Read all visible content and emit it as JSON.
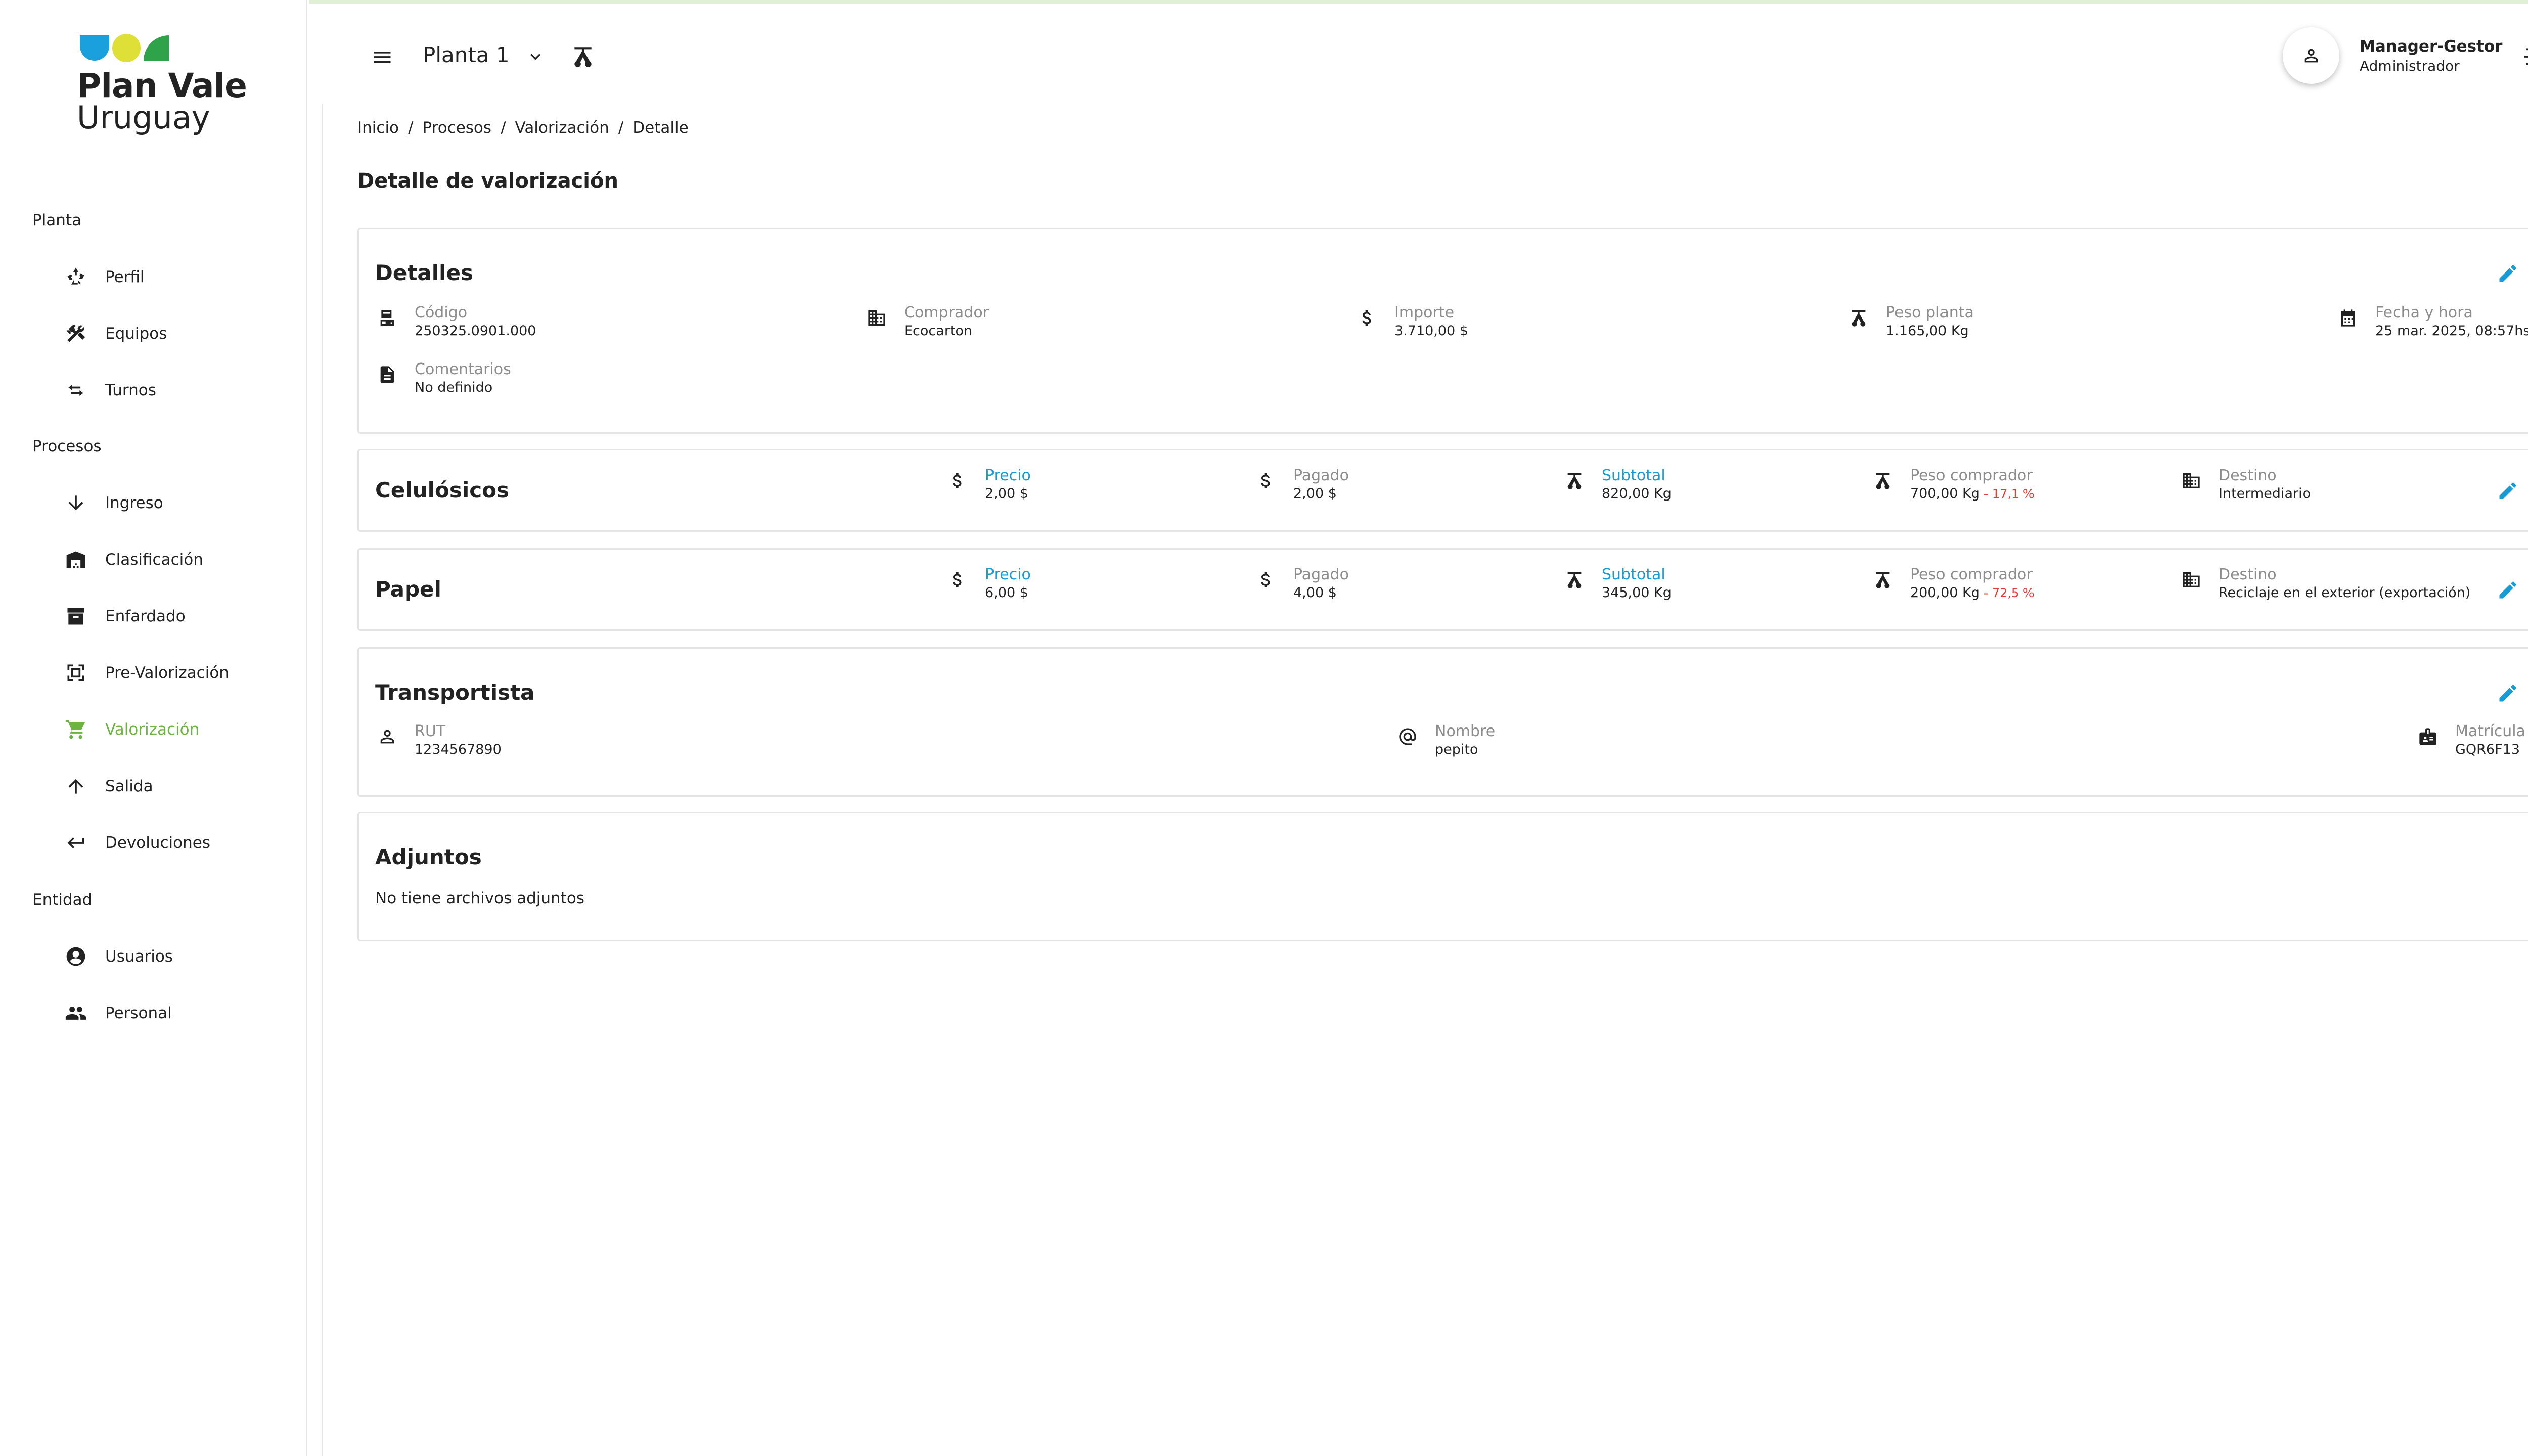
{
  "brand": {
    "line1": "Plan Vale",
    "line2": "Uruguay",
    "colors": {
      "blue": "#1aa0dc",
      "yellow": "#dfe037",
      "green": "#2ea34a"
    }
  },
  "sidebar": {
    "sections": [
      {
        "title": "Planta"
      },
      {
        "title": "Procesos"
      },
      {
        "title": "Entidad"
      }
    ],
    "items": [
      {
        "label": "Perfil",
        "icon": "recycle-icon"
      },
      {
        "label": "Equipos",
        "icon": "tools-icon"
      },
      {
        "label": "Turnos",
        "icon": "swap-icon"
      },
      {
        "label": "Ingreso",
        "icon": "arrow-down-icon"
      },
      {
        "label": "Clasificación",
        "icon": "warehouse-icon"
      },
      {
        "label": "Enfardado",
        "icon": "archive-icon"
      },
      {
        "label": "Pre-Valorización",
        "icon": "frame-icon"
      },
      {
        "label": "Valorización",
        "icon": "cart-icon",
        "active": true
      },
      {
        "label": "Salida",
        "icon": "arrow-up-icon"
      },
      {
        "label": "Devoluciones",
        "icon": "return-icon"
      },
      {
        "label": "Usuarios",
        "icon": "account-circle-icon"
      },
      {
        "label": "Personal",
        "icon": "people-icon"
      }
    ],
    "active_color": "#6cb33f"
  },
  "topbar": {
    "plant": "Planta 1",
    "user_name": "Manager-Gestor",
    "user_role": "Administrador"
  },
  "breadcrumb": [
    "Inicio",
    "/",
    "Procesos",
    "/",
    "Valorización",
    "/",
    "Detalle"
  ],
  "page_title": "Detalle de valorización",
  "details": {
    "title": "Detalles",
    "codigo": {
      "label": "Código",
      "value": "250325.0901.000"
    },
    "comprador": {
      "label": "Comprador",
      "value": "Ecocarton"
    },
    "importe": {
      "label": "Importe",
      "value": "3.710,00 $"
    },
    "peso_planta": {
      "label": "Peso planta",
      "value": "1.165,00 Kg"
    },
    "fecha": {
      "label": "Fecha y hora",
      "value": "25 mar. 2025, 08:57hs."
    },
    "comentarios": {
      "label": "Comentarios",
      "value": "No definido"
    }
  },
  "materials": [
    {
      "name": "Celulósicos",
      "precio": {
        "label": "Precio",
        "value": "2,00 $"
      },
      "pagado": {
        "label": "Pagado",
        "value": "2,00 $"
      },
      "subtotal": {
        "label": "Subtotal",
        "value": "820,00 Kg"
      },
      "peso_comprador": {
        "label": "Peso comprador",
        "value": "700,00 Kg",
        "delta": " - 17,1 %"
      },
      "destino": {
        "label": "Destino",
        "value": "Intermediario"
      }
    },
    {
      "name": "Papel",
      "precio": {
        "label": "Precio",
        "value": "6,00 $"
      },
      "pagado": {
        "label": "Pagado",
        "value": "4,00 $"
      },
      "subtotal": {
        "label": "Subtotal",
        "value": "345,00 Kg"
      },
      "peso_comprador": {
        "label": "Peso comprador",
        "value": "200,00 Kg",
        "delta": " - 72,5 %"
      },
      "destino": {
        "label": "Destino",
        "value": "Reciclaje en el exterior (exportación)"
      }
    }
  ],
  "transportista": {
    "title": "Transportista",
    "rut": {
      "label": "RUT",
      "value": "1234567890"
    },
    "nombre": {
      "label": "Nombre",
      "value": "pepito"
    },
    "matricula": {
      "label": "Matrícula",
      "value": "GQR6F13"
    }
  },
  "adjuntos": {
    "title": "Adjuntos",
    "empty": "No tiene archivos adjuntos"
  },
  "colors": {
    "accent": "#169bd5",
    "negative": "#e53935",
    "active_nav": "#6cb33f"
  }
}
